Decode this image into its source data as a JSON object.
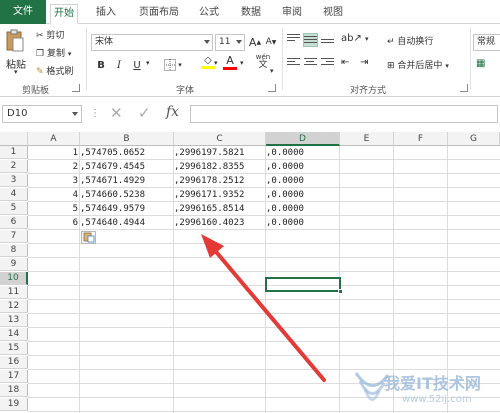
{
  "tabs": [
    "文件",
    "开始",
    "插入",
    "页面布局",
    "公式",
    "数据",
    "审阅",
    "视图"
  ],
  "clipboard": {
    "paste_label": "粘贴",
    "cut_label": "剪切",
    "copy_label": "复制",
    "format_painter_label": "格式刷",
    "group_label": "剪贴板"
  },
  "font": {
    "font_name": "宋体",
    "font_size": "11",
    "grow_label": "A",
    "shrink_label": "A",
    "bold_label": "B",
    "italic_label": "I",
    "underline_label": "U",
    "fill_label": "◇",
    "color_label": "A",
    "wen_label": "wén",
    "group_label": "字体"
  },
  "alignment": {
    "wrap_label": "自动换行",
    "merge_label": "合并后居中",
    "group_label": "对齐方式"
  },
  "number": {
    "format_label": "常规"
  },
  "formula_bar": {
    "name_box": "D10",
    "fx_label": "fx"
  },
  "grid": {
    "columns": [
      "A",
      "B",
      "C",
      "D",
      "E",
      "F",
      "G"
    ],
    "rows": [
      "1",
      "2",
      "3",
      "4",
      "5",
      "6",
      "7",
      "8",
      "9",
      "10",
      "11",
      "12",
      "13",
      "14",
      "15",
      "16",
      "17",
      "18",
      "19"
    ],
    "selected_column": "D",
    "selected_row": "10",
    "cells": [
      {
        "a": "1",
        "b": ",574705.0652",
        "c": ",2996197.5821",
        "d": ",0.0000"
      },
      {
        "a": "2",
        "b": ",574679.4545",
        "c": ",2996182.8355",
        "d": ",0.0000"
      },
      {
        "a": "3",
        "b": ",574671.4929",
        "c": ",2996178.2512",
        "d": ",0.0000"
      },
      {
        "a": "4",
        "b": ",574660.5238",
        "c": ",2996171.9352",
        "d": ",0.0000"
      },
      {
        "a": "5",
        "b": ",574649.9579",
        "c": ",2996165.8514",
        "d": ",0.0000"
      },
      {
        "a": "6",
        "b": ",574640.4944",
        "c": ",2996160.4023",
        "d": ",0.0000"
      }
    ]
  },
  "watermark": {
    "title": "我爱IT技术网",
    "url": "www.52ij.com"
  },
  "colors": {
    "accent": "#217346",
    "annotation_arrow": "#e53935"
  }
}
